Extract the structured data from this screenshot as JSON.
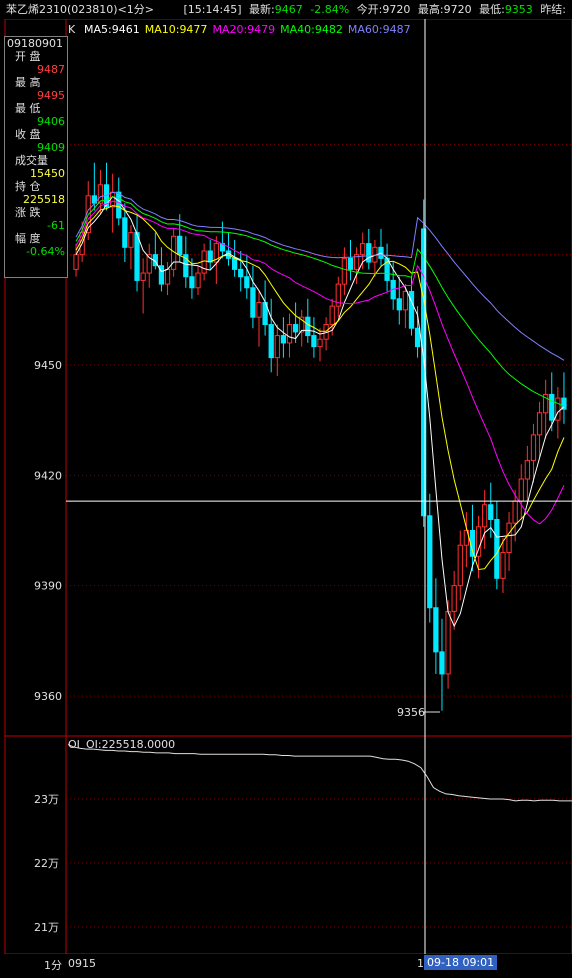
{
  "header": {
    "symbol": "苯乙烯2310",
    "code": "(023810)",
    "period": "<1分>",
    "time": "[15:14:45]",
    "last_label": "最新:",
    "last_value": "9467",
    "change_pct": "-2.84%",
    "open_label": "今开:",
    "open_value": "9720",
    "high_label": "最高:",
    "high_value": "9720",
    "low_label": "最低:",
    "low_value": "9353",
    "prev_label": "昨结:"
  },
  "ma_legend": {
    "k_label": "K",
    "items": [
      {
        "label": "MA5:9461",
        "color": "#ffffff"
      },
      {
        "label": "MA10:9477",
        "color": "#ffff00"
      },
      {
        "label": "MA20:9479",
        "color": "#ff00ff"
      },
      {
        "label": "MA40:9482",
        "color": "#00ff00"
      },
      {
        "label": "MA60:9487",
        "color": "#8080ff"
      }
    ]
  },
  "info_panel": {
    "date": "09180901",
    "open_label": "开  盘",
    "open_value": "9487",
    "high_label": "最  高",
    "high_value": "9495",
    "low_label": "最  低",
    "low_value": "9406",
    "close_label": "收  盘",
    "close_value": "9409",
    "volume_label": "成交量",
    "volume_value": "15450",
    "oi_label": "持  仓",
    "oi_value": "225518",
    "change_label": "涨  跌",
    "change_value": "-61",
    "pct_label": "幅  度",
    "pct_value": "-0.64%"
  },
  "oi_panel": {
    "label": "OI",
    "value_text": "OI:225518.0000",
    "y_labels": [
      "23万",
      "22万",
      "21万"
    ]
  },
  "footer": {
    "period_label": "1分",
    "start_time": "0915",
    "cursor_marker": "1",
    "cursor_time": "09-18 09:01"
  },
  "annotations": {
    "low_marker": "9356"
  },
  "chart_data": {
    "type": "candlestick",
    "y_ticks": [
      9450,
      9420,
      9390,
      9360
    ],
    "crosshair_price": 9413,
    "candles": [
      [
        9476,
        9483,
        9474,
        9480
      ],
      [
        9480,
        9489,
        9478,
        9486
      ],
      [
        9486,
        9500,
        9484,
        9496
      ],
      [
        9496,
        9505,
        9492,
        9494
      ],
      [
        9494,
        9503,
        9491,
        9499
      ],
      [
        9499,
        9505,
        9492,
        9493
      ],
      [
        9493,
        9502,
        9486,
        9497
      ],
      [
        9497,
        9501,
        9488,
        9490
      ],
      [
        9490,
        9494,
        9478,
        9482
      ],
      [
        9482,
        9488,
        9476,
        9486
      ],
      [
        9486,
        9491,
        9470,
        9473
      ],
      [
        9473,
        9479,
        9464,
        9475
      ],
      [
        9475,
        9483,
        9471,
        9480
      ],
      [
        9480,
        9486,
        9476,
        9477
      ],
      [
        9477,
        9482,
        9470,
        9472
      ],
      [
        9472,
        9478,
        9469,
        9476
      ],
      [
        9476,
        9487,
        9474,
        9485
      ],
      [
        9485,
        9491,
        9478,
        9480
      ],
      [
        9480,
        9485,
        9471,
        9474
      ],
      [
        9474,
        9479,
        9468,
        9471
      ],
      [
        9471,
        9477,
        9469,
        9475
      ],
      [
        9475,
        9483,
        9473,
        9481
      ],
      [
        9481,
        9484,
        9476,
        9478
      ],
      [
        9478,
        9485,
        9472,
        9483
      ],
      [
        9483,
        9489,
        9479,
        9481
      ],
      [
        9481,
        9486,
        9477,
        9479
      ],
      [
        9479,
        9484,
        9474,
        9476
      ],
      [
        9476,
        9481,
        9470,
        9474
      ],
      [
        9474,
        9480,
        9468,
        9471
      ],
      [
        9471,
        9477,
        9460,
        9463
      ],
      [
        9463,
        9470,
        9455,
        9467
      ],
      [
        9467,
        9473,
        9458,
        9461
      ],
      [
        9461,
        9468,
        9448,
        9452
      ],
      [
        9452,
        9461,
        9447,
        9458
      ],
      [
        9458,
        9463,
        9452,
        9456
      ],
      [
        9456,
        9464,
        9452,
        9461
      ],
      [
        9461,
        9467,
        9456,
        9459
      ],
      [
        9459,
        9465,
        9455,
        9463
      ],
      [
        9463,
        9468,
        9456,
        9458
      ],
      [
        9458,
        9463,
        9452,
        9455
      ],
      [
        9455,
        9460,
        9451,
        9457
      ],
      [
        9457,
        9463,
        9454,
        9461
      ],
      [
        9461,
        9468,
        9458,
        9466
      ],
      [
        9466,
        9474,
        9463,
        9472
      ],
      [
        9472,
        9482,
        9469,
        9479
      ],
      [
        9479,
        9484,
        9473,
        9476
      ],
      [
        9476,
        9482,
        9472,
        9480
      ],
      [
        9480,
        9486,
        9476,
        9483
      ],
      [
        9483,
        9487,
        9476,
        9478
      ],
      [
        9478,
        9484,
        9474,
        9482
      ],
      [
        9482,
        9487,
        9477,
        9479
      ],
      [
        9479,
        9483,
        9470,
        9473
      ],
      [
        9473,
        9478,
        9465,
        9468
      ],
      [
        9468,
        9474,
        9461,
        9465
      ],
      [
        9465,
        9472,
        9460,
        9470
      ],
      [
        9470,
        9474,
        9458,
        9460
      ],
      [
        9460,
        9466,
        9452,
        9455
      ],
      [
        9487,
        9495,
        9406,
        9409
      ],
      [
        9409,
        9415,
        9380,
        9384
      ],
      [
        9384,
        9392,
        9366,
        9372
      ],
      [
        9372,
        9381,
        9356,
        9366
      ],
      [
        9366,
        9386,
        9362,
        9383
      ],
      [
        9383,
        9394,
        9378,
        9390
      ],
      [
        9390,
        9405,
        9386,
        9401
      ],
      [
        9401,
        9410,
        9395,
        9405
      ],
      [
        9405,
        9412,
        9394,
        9398
      ],
      [
        9398,
        9409,
        9392,
        9406
      ],
      [
        9406,
        9416,
        9400,
        9412
      ],
      [
        9412,
        9418,
        9403,
        9408
      ],
      [
        9408,
        9413,
        9389,
        9392
      ],
      [
        9392,
        9403,
        9388,
        9399
      ],
      [
        9399,
        9410,
        9394,
        9407
      ],
      [
        9407,
        9416,
        9402,
        9413
      ],
      [
        9413,
        9423,
        9408,
        9419
      ],
      [
        9419,
        9428,
        9412,
        9424
      ],
      [
        9424,
        9434,
        9418,
        9431
      ],
      [
        9431,
        9440,
        9425,
        9437
      ],
      [
        9437,
        9446,
        9430,
        9442
      ],
      [
        9442,
        9448,
        9432,
        9435
      ],
      [
        9435,
        9444,
        9430,
        9441
      ],
      [
        9441,
        9448,
        9434,
        9438
      ]
    ],
    "ma_series": [
      {
        "name": "MA5",
        "color": "#ffffff"
      },
      {
        "name": "MA10",
        "color": "#ffff00"
      },
      {
        "name": "MA20",
        "color": "#ff00ff"
      },
      {
        "name": "MA40",
        "color": "#00ff00"
      },
      {
        "name": "MA60",
        "color": "#8080ff"
      }
    ],
    "oi_series": [
      238500,
      238100,
      237900,
      237800,
      237800,
      237700,
      237600,
      237600,
      237500,
      237500,
      237400,
      237400,
      237300,
      237300,
      237200,
      237200,
      237200,
      237100,
      237100,
      237100,
      237100,
      237000,
      237000,
      237000,
      237000,
      237000,
      237000,
      237000,
      237000,
      237000,
      237000,
      237000,
      236900,
      236900,
      236800,
      236800,
      236700,
      236700,
      236700,
      236700,
      236700,
      236700,
      236700,
      236700,
      236700,
      236700,
      236700,
      236700,
      236700,
      236500,
      236300,
      236200,
      236200,
      236100,
      235900,
      235500,
      234900,
      233500,
      231800,
      231200,
      230800,
      230700,
      230500,
      230400,
      230300,
      230200,
      230100,
      230000,
      230000,
      230000,
      229900,
      229700,
      229800,
      229800,
      229700,
      229800,
      229800,
      229800,
      229700,
      229700,
      229700
    ]
  }
}
